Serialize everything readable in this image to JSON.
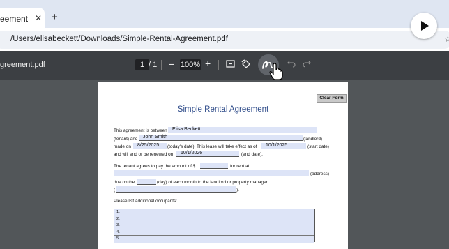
{
  "browser": {
    "tab_title": "eement",
    "tab_close": "✕",
    "new_tab": "+",
    "url": "/Users/elisabeckett/Downloads/Simple-Rental-Agreement.pdf"
  },
  "pdf_toolbar": {
    "file_name": "greement.pdf",
    "current_page": "1",
    "total_pages": "/ 1",
    "zoom_minus": "−",
    "zoom": "100%",
    "zoom_plus": "+"
  },
  "document": {
    "clear_form_label": "Clear Form",
    "title": "Simple Rental Agreement",
    "line1_prefix": "This agreement is between",
    "landlord_name": "Elisa Beckett",
    "line2_prefix": "(tenant) and",
    "tenant_name": "John Smith",
    "line2_suffix": "(landlord)",
    "line3_prefix": "made on",
    "made_on_date": "8/25/2025",
    "line3_mid": "(today's date). This lease will take effect as of",
    "start_date": "10/1/2025",
    "line3_suffix": "(start date)",
    "line4_prefix": "and will end or be renewed on",
    "end_date": "10/1/2026",
    "line4_suffix": "(end date).",
    "line5_prefix": "The tenant agrees to pay the amount of $",
    "line5_suffix": "for rent at",
    "address_suffix": "(address)",
    "line7_prefix": "due on the",
    "line7_suffix": "(day) of each month to the landlord or property manager",
    "line8_open": "(",
    "line8_close": ").",
    "occupants_label": "Please list additional occupants:",
    "occupants": [
      "1.",
      "2.",
      "3.",
      "4.",
      "5."
    ]
  }
}
